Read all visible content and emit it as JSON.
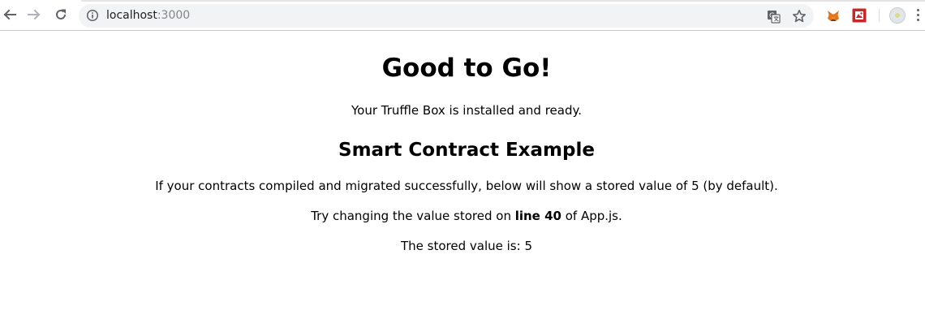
{
  "browser": {
    "url_host": "localhost",
    "url_port": ":3000",
    "icons": {
      "back": "arrow-left-icon",
      "forward": "arrow-right-icon",
      "reload": "reload-icon",
      "info": "info-icon",
      "translate": "translate-icon",
      "bookmark": "star-icon",
      "extension_1": "metamask-fox-icon",
      "extension_2": "red-extension-icon",
      "profile": "profile-avatar-icon",
      "menu": "kebab-menu-icon"
    }
  },
  "page": {
    "heading": "Good to Go!",
    "subtitle": "Your Truffle Box is installed and ready.",
    "section_heading": "Smart Contract Example",
    "instructions": "If your contracts compiled and migrated successfully, below will show a stored value of 5 (by default).",
    "try_prefix": "Try changing the value stored on ",
    "try_bold": "line 40",
    "try_suffix": " of App.js.",
    "stored_value_label": "The stored value is: 5"
  }
}
